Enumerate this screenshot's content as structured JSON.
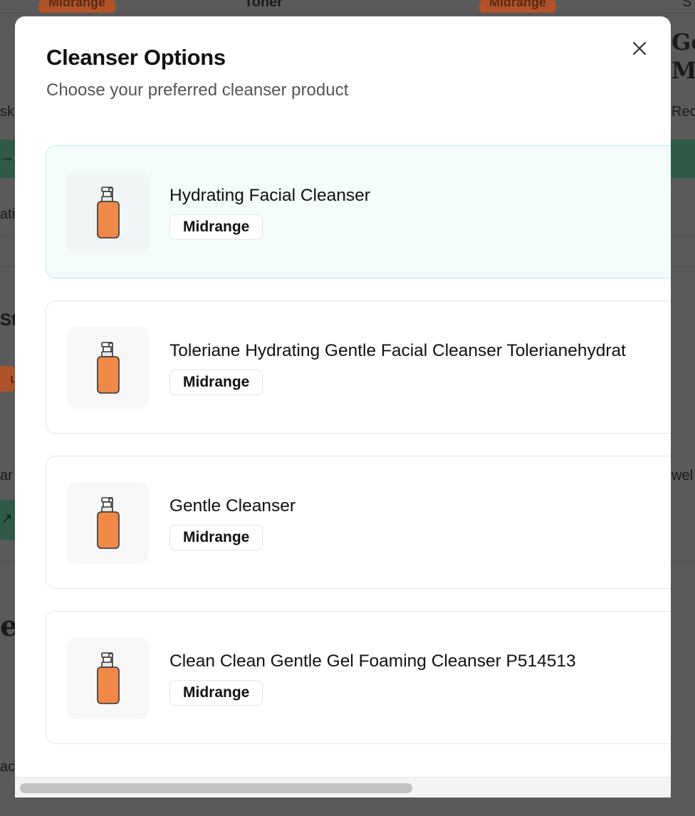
{
  "background": {
    "tag_left": "Midrange",
    "tag_right": "Midrange",
    "toner_label": "Toner",
    "right_heading_line1": "Go",
    "right_heading_line2": "Ma",
    "right_text_1": "Rec",
    "right_text_top": "S",
    "left_text_1": "sk",
    "left_text_2": "ativ",
    "left_heading": "Ste",
    "left_text_3": "uc",
    "left_text_4": "ar",
    "right_text_2": "wel",
    "left_serif": "e",
    "left_text_5": "ac"
  },
  "modal": {
    "title": "Cleanser Options",
    "subtitle": "Choose your preferred cleanser product",
    "close_icon": "close-icon",
    "product_icon": "pump-bottle-icon",
    "accent_color": "#f0884a",
    "selected_bg": "#f3fcfb",
    "selected_border": "#b8ece4",
    "products": [
      {
        "name": "Hydrating Facial Cleanser",
        "price_tier": "Midrange",
        "selected": true
      },
      {
        "name": "Toleriane Hydrating Gentle Facial Cleanser Tolerianehydrat",
        "price_tier": "Midrange",
        "selected": false
      },
      {
        "name": "Gentle Cleanser",
        "price_tier": "Midrange",
        "selected": false
      },
      {
        "name": "Clean Clean Gentle Gel Foaming Cleanser P514513",
        "price_tier": "Midrange",
        "selected": false
      }
    ],
    "horizontal_scroll_fraction": 0.6
  }
}
